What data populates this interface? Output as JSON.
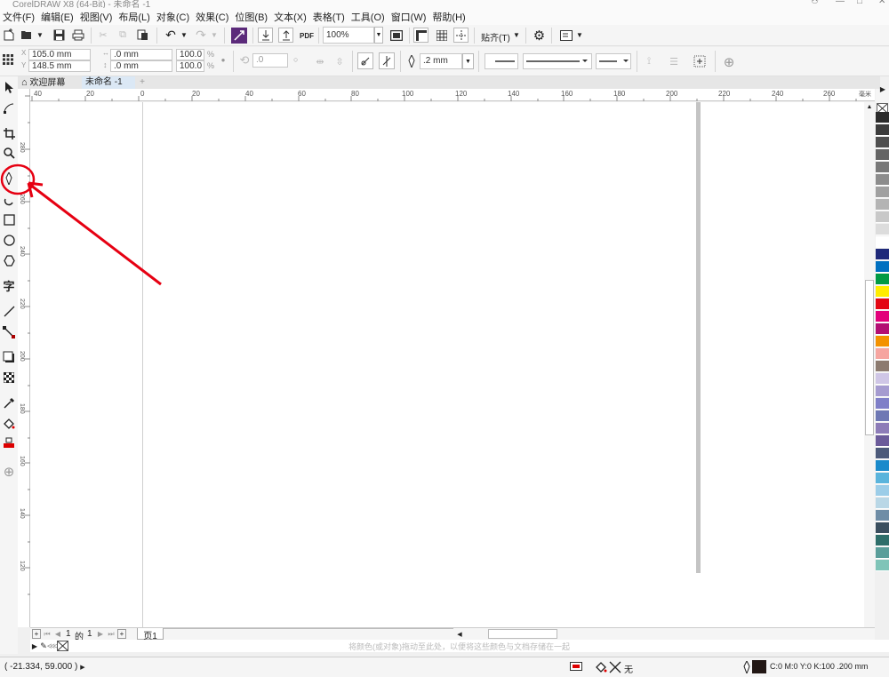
{
  "window": {
    "title": "CorelDRAW X8 (64-Bit) - 未命名 -1"
  },
  "menu": [
    {
      "label": "文件(F)"
    },
    {
      "label": "编辑(E)"
    },
    {
      "label": "视图(V)"
    },
    {
      "label": "布局(L)"
    },
    {
      "label": "对象(C)"
    },
    {
      "label": "效果(C)"
    },
    {
      "label": "位图(B)"
    },
    {
      "label": "文本(X)"
    },
    {
      "label": "表格(T)"
    },
    {
      "label": "工具(O)"
    },
    {
      "label": "窗口(W)"
    },
    {
      "label": "帮助(H)"
    }
  ],
  "toolbar": {
    "zoom_value": "100%",
    "snap_label": "贴齐(T)",
    "pdf_label": "PDF"
  },
  "properties": {
    "x": "105.0 mm",
    "y": "148.5 mm",
    "width": ".0 mm",
    "height": ".0 mm",
    "scale_x": "100.0",
    "scale_y": "100.0",
    "percent": "%",
    "rotation": ".0",
    "outline_width": ".2 mm"
  },
  "tabs": {
    "welcome": "欢迎屏幕",
    "document": "未命名 -1",
    "add": "+"
  },
  "ruler": {
    "h_labels": [
      "40",
      "20",
      "0",
      "20",
      "40",
      "60",
      "80",
      "100",
      "120",
      "140",
      "160",
      "180",
      "200",
      "220",
      "240",
      "260"
    ],
    "v_labels": [
      "280",
      "260",
      "240",
      "220",
      "200",
      "180",
      "160",
      "140",
      "120",
      "100",
      "80"
    ],
    "unit": "毫米"
  },
  "pager": {
    "current": "1",
    "of_label": "的",
    "total": "1",
    "page_tab": "页1",
    "hint": "将颜色(或对象)拖动至此处，以便将这些颜色与文档存储在一起"
  },
  "status": {
    "coords": "( -21.334, 59.000 )",
    "fill_none": "无",
    "outline_info": "C:0 M:0 Y:0 K:100 .200 mm"
  },
  "colors": {
    "accent": "#ff0000",
    "palette": [
      "#2b2b2b",
      "#3c3c3c",
      "#4f4f4f",
      "#646464",
      "#787878",
      "#8c8c8c",
      "#a0a0a0",
      "#b4b4b4",
      "#c8c8c8",
      "#dcdcdc",
      "#ffffff",
      "#1f2a7a",
      "#0070c0",
      "#009a44",
      "#ffed00",
      "#e30613",
      "#e2007a",
      "#b30f73",
      "#f39200",
      "#f6a5a0",
      "#8c7b70",
      "#cfc6e6",
      "#a59bd0",
      "#7f7fc8",
      "#6e78b4",
      "#8d7cb8",
      "#6b5b9a",
      "#4c5a7a",
      "#1a8acb",
      "#5ab4dc",
      "#9ccde8",
      "#b9d7e6",
      "#6f8da6",
      "#3a4e5e",
      "#2e6e6a",
      "#5a9e9a",
      "#7fc4b8"
    ]
  },
  "tools": [
    {
      "name": "pick-tool",
      "icon": "arrow-icon"
    },
    {
      "name": "shape-tool",
      "icon": "shape-edit-icon"
    },
    {
      "name": "crop-tool",
      "icon": "crop-icon"
    },
    {
      "name": "zoom-tool",
      "icon": "magnifier-icon"
    },
    {
      "name": "freehand-tool",
      "icon": "pen-icon"
    },
    {
      "name": "artistic-media-tool",
      "icon": "brush-icon"
    },
    {
      "name": "rectangle-tool",
      "icon": "rectangle-icon"
    },
    {
      "name": "ellipse-tool",
      "icon": "ellipse-icon"
    },
    {
      "name": "polygon-tool",
      "icon": "polygon-icon"
    },
    {
      "name": "text-tool",
      "icon": "text-icon"
    },
    {
      "name": "dimension-tool",
      "icon": "dimension-icon"
    },
    {
      "name": "connector-tool",
      "icon": "connector-icon"
    },
    {
      "name": "drop-shadow-tool",
      "icon": "shadow-icon"
    },
    {
      "name": "transparency-tool",
      "icon": "checker-icon"
    },
    {
      "name": "eyedropper-tool",
      "icon": "eyedropper-icon"
    },
    {
      "name": "interactive-fill-tool",
      "icon": "fill-bucket-icon"
    },
    {
      "name": "smart-fill-tool",
      "icon": "smart-fill-icon"
    },
    {
      "name": "add-tool",
      "icon": "plus-circle-icon"
    }
  ]
}
